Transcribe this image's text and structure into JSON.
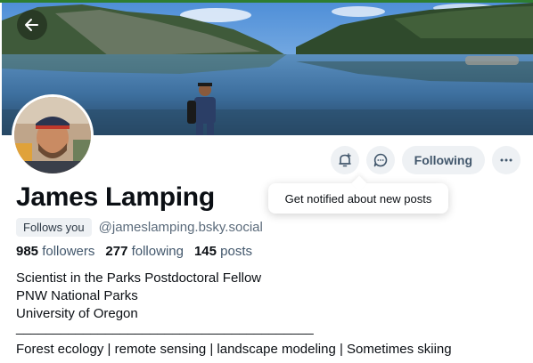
{
  "profile": {
    "name": "James Lamping",
    "follows_you": "Follows you",
    "handle": "@jameslamping.bsky.social",
    "stats": {
      "followers_count": "985",
      "followers_label": "followers",
      "following_count": "277",
      "following_label": "following",
      "posts_count": "145",
      "posts_label": "posts"
    },
    "bio": {
      "line1": "Scientist in the Parks Postdoctoral Fellow",
      "line2": "PNW National Parks",
      "line3": "University of Oregon",
      "line4": "________________________________________",
      "line5": "Forest ecology | remote sensing | landscape modeling | Sometimes skiing"
    }
  },
  "actions": {
    "following_label": "Following"
  },
  "tooltip": {
    "text": "Get notified about new posts"
  },
  "icons": {
    "back": "arrow-left-icon",
    "notify": "bell-plus-icon",
    "message": "chat-bubble-icon",
    "more": "ellipsis-icon"
  },
  "colors": {
    "accent_stripe": "#2e7d32",
    "button_bg": "#eef1f4",
    "muted_text": "#5b6b7b"
  }
}
